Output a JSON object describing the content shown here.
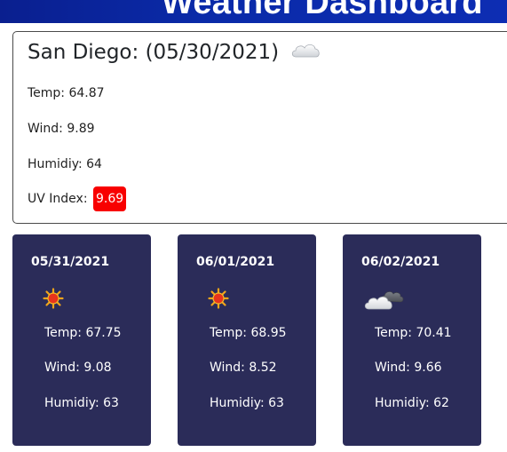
{
  "header": {
    "title": "Weather Dashboard"
  },
  "current": {
    "title": "San Diego: (05/30/2021)",
    "icon": "cloud-icon",
    "temp": "Temp: 64.87",
    "wind": "Wind: 9.89",
    "humidity": "Humidiy: 64",
    "uv_label": "UV Index:",
    "uv_value": "9.69",
    "uv_color": "#f80000"
  },
  "forecast": [
    {
      "date": "05/31/2021",
      "icon": "sun-icon",
      "temp": "Temp: 67.75",
      "wind": "Wind: 9.08",
      "humidity": "Humidiy: 63"
    },
    {
      "date": "06/01/2021",
      "icon": "sun-icon",
      "temp": "Temp: 68.95",
      "wind": "Wind: 8.52",
      "humidity": "Humidiy: 63"
    },
    {
      "date": "06/02/2021",
      "icon": "cloudy-icon",
      "temp": "Temp: 70.41",
      "wind": "Wind: 9.66",
      "humidity": "Humidiy: 62"
    }
  ],
  "colors": {
    "header": "#0a2aa8",
    "card": "#2b2c59",
    "uv_badge": "#f80000"
  }
}
